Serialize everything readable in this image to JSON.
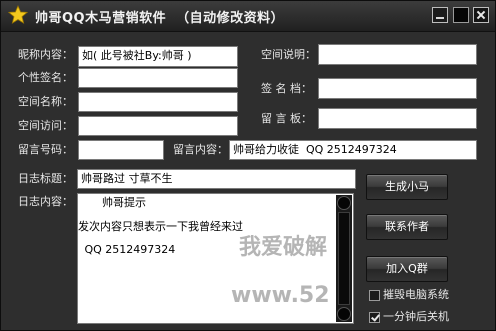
{
  "window": {
    "title": "帅哥QQ木马营销软件  （自动修改资料）"
  },
  "fields": {
    "nickname": {
      "label": "昵称内容：",
      "value": "如( 此号被社By:帅哥 )"
    },
    "signature": {
      "label": "个性签名：",
      "value": ""
    },
    "space_name": {
      "label": "空间名称：",
      "value": ""
    },
    "space_visit": {
      "label": "空间访问：",
      "value": ""
    },
    "space_desc": {
      "label": "空间说明：",
      "value": ""
    },
    "file_sign": {
      "label": "签 名 档：",
      "value": ""
    },
    "message_board": {
      "label": "留 言 板：",
      "value": ""
    },
    "message_number": {
      "label": "留言号码：",
      "value": ""
    },
    "message_content": {
      "label": "留言内容：",
      "value": "帅哥给力收徒  QQ 2512497324"
    },
    "log_title": {
      "label": "日志标题：",
      "value": "帅哥路过 寸草不生"
    },
    "log_content": {
      "label": "日志内容：",
      "lines": [
        "      帅哥提示",
        "发次内容只想表示一下我曾经来过",
        " QQ 2512497324"
      ]
    }
  },
  "buttons": {
    "generate": "生成小马",
    "contact": "联系作者",
    "join_group": "加入Q群"
  },
  "options": {
    "destroy_system": {
      "label": "摧毁电脑系统",
      "checked": false
    },
    "shutdown": {
      "label": "一分钟后关机",
      "checked": true
    }
  },
  "watermark": {
    "main": "我爱破解",
    "url": "www.52"
  }
}
